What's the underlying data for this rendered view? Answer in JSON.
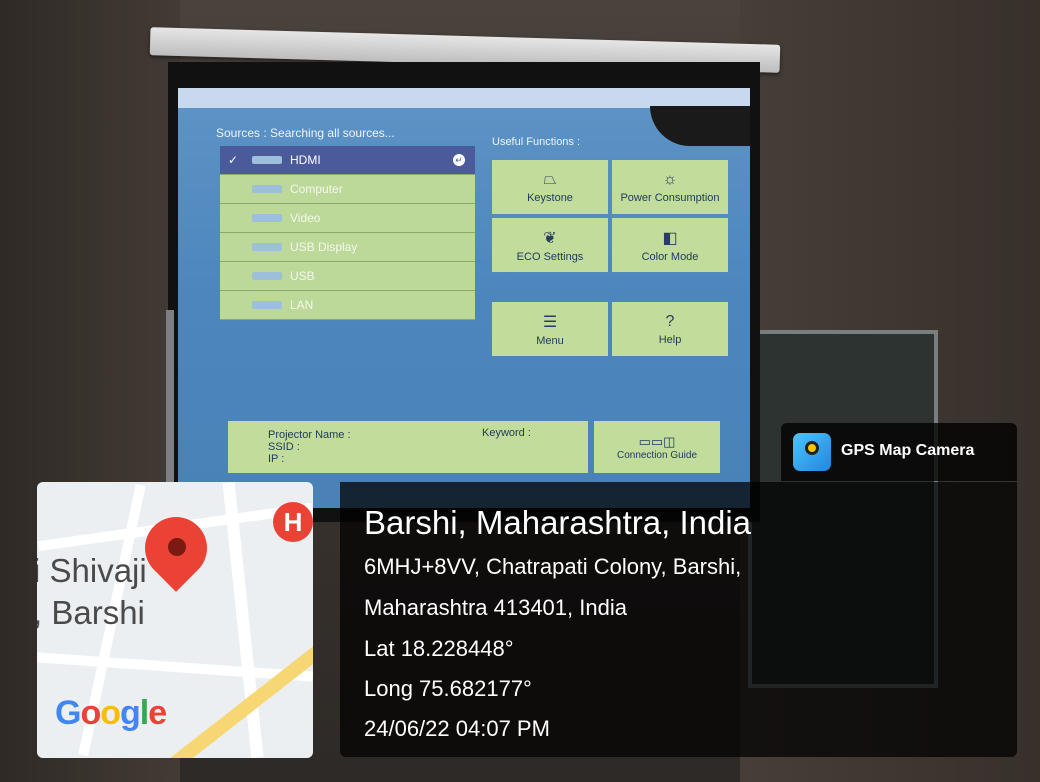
{
  "projector": {
    "sources_title": "Sources :  Searching all sources...",
    "useful_title": "Useful Functions :",
    "sources": [
      {
        "label": "HDMI",
        "selected": true
      },
      {
        "label": "Computer",
        "selected": false
      },
      {
        "label": "Video",
        "selected": false
      },
      {
        "label": "USB Display",
        "selected": false
      },
      {
        "label": "USB",
        "selected": false
      },
      {
        "label": "LAN",
        "selected": false
      }
    ],
    "functions": [
      {
        "label": "Keystone",
        "icon": "keystone-icon"
      },
      {
        "label": "Power Consumption",
        "icon": "sun-icon"
      },
      {
        "label": "ECO Settings",
        "icon": "leaf-icon"
      },
      {
        "label": "Color Mode",
        "icon": "color-mode-icon"
      },
      {
        "label": "Menu",
        "icon": "menu-icon"
      },
      {
        "label": "Help",
        "icon": "help-icon"
      }
    ],
    "projector_name_label": "Projector Name :",
    "ssid_label": "SSID :",
    "ip_label": "IP :",
    "keyword_label": "Keyword :",
    "connection_guide": "Connection Guide"
  },
  "gps": {
    "app_name": "GPS Map Camera",
    "city": "Barshi, Maharashtra, India",
    "address_line1": "6MHJ+8VV, Chatrapati Colony, Barshi,",
    "address_line2": "Maharashtra 413401, India",
    "lat": "Lat 18.228448°",
    "long": "Long 75.682177°",
    "datetime": "24/06/22 04:07 PM"
  },
  "map": {
    "label_line1": "i Shivaji",
    "label_line2": ", Barshi",
    "logo": "Google",
    "hospital_letter": "H"
  }
}
